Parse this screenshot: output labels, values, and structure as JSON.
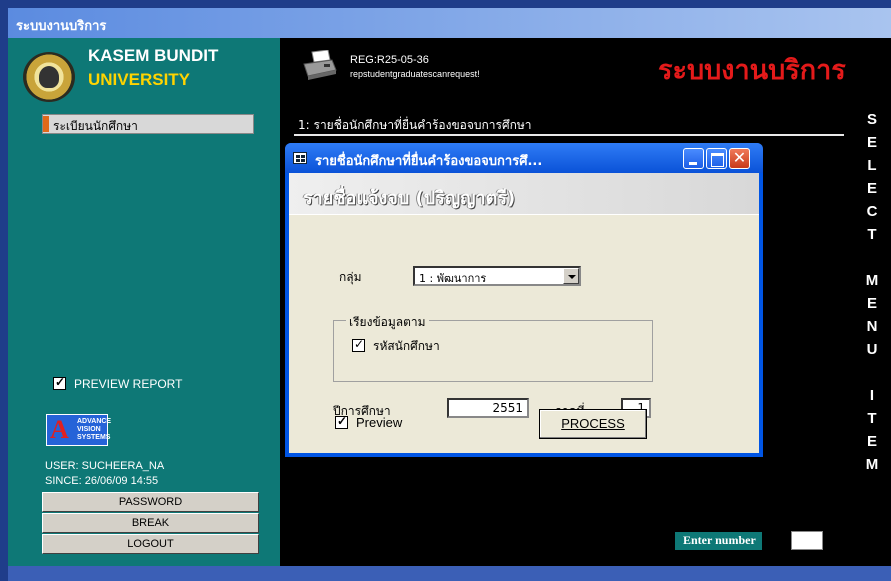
{
  "window": {
    "title": "ระบบงานบริการ"
  },
  "sidebar": {
    "university_line1": "KASEM BUNDIT",
    "university_line2": "UNIVERSITY",
    "menu_item": "ระเบียนนักศึกษา",
    "preview_report_label": "PREVIEW REPORT",
    "preview_report_checked": true,
    "avs_logo": {
      "letter": "A",
      "line1": "ADVANCE",
      "line2": "VISION",
      "line3": "SYSTEMS"
    },
    "user_text": "USER: SUCHEERA_NA",
    "since_text": "SINCE: 26/06/09 14:55",
    "buttons": {
      "password": "PASSWORD",
      "break": "BREAK",
      "logout": "LOGOUT"
    }
  },
  "main": {
    "report_code": "REG:R25-05-36",
    "report_name": "repstudentgraduatescanrequest!",
    "system_name": "ระบบงานบริการ",
    "heading": "1: รายชื่อนักศึกษาที่ยื่นคำร้องขอจบการศึกษา",
    "vertical_letters": [
      "S",
      "E",
      "L",
      "E",
      "C",
      "T",
      "",
      "M",
      "E",
      "N",
      "U",
      "",
      "I",
      "T",
      "E",
      "M"
    ],
    "enter_number_label": "Enter number",
    "enter_number_value": ""
  },
  "dialog": {
    "title": "รายชื่อนักศึกษาที่ยื่นคำร้องขอจบการศึ...",
    "header": "รายชื่อแจ้งจบ (ปริญญาตรี)",
    "group_label": "กลุ่ม",
    "group_value": "1 : พัฒนาการ",
    "sort_legend": "เรียงข้อมูลตาม",
    "sort_option": "รหัสนักศึกษา",
    "sort_option_checked": true,
    "year_label": "ปีการศึกษา",
    "year_value": "2551",
    "term_label": "ภาคที่",
    "term_value": "1",
    "preview_label": "Preview",
    "preview_checked": true,
    "process_label": "PROCESS"
  },
  "colors": {
    "sidebar": "#0e7876",
    "main": "#000000",
    "accent_red": "#e41a1a",
    "title_bar": "#0055e5"
  }
}
